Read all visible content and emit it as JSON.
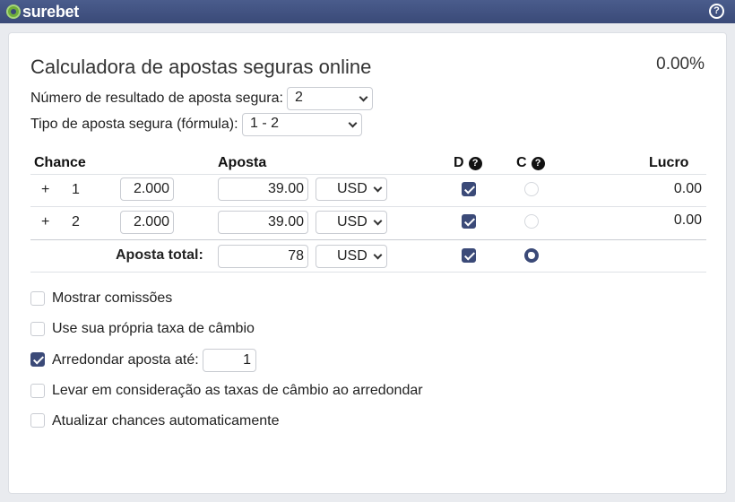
{
  "header": {
    "brand": "surebet",
    "help_glyph": "?"
  },
  "colors": {
    "header_bg": "#3a4a78",
    "accent": "#3b4a78",
    "logo_green": "#6fae3a"
  },
  "calculator": {
    "title": "Calculadora de apostas seguras online",
    "percent": "0.00%",
    "outcomes_label": "Número de resultado de aposta segura:",
    "outcomes_value": "2",
    "formula_label": "Tipo de aposta segura (fórmula):",
    "formula_value": "1 - 2",
    "columns": {
      "chance": "Chance",
      "aposta": "Aposta",
      "d": "D",
      "c": "C",
      "lucro": "Lucro",
      "q": "?"
    },
    "rows": [
      {
        "plus": "+",
        "num": "1",
        "odds": "2.000",
        "stake": "39.00",
        "currency": "USD",
        "d_checked": true,
        "c_checked": false,
        "profit": "0.00"
      },
      {
        "plus": "+",
        "num": "2",
        "odds": "2.000",
        "stake": "39.00",
        "currency": "USD",
        "d_checked": true,
        "c_checked": false,
        "profit": "0.00"
      }
    ],
    "total": {
      "label": "Aposta total:",
      "stake": "78",
      "currency": "USD",
      "d_checked": true,
      "c_checked": true
    }
  },
  "options": {
    "show_commissions": {
      "label": "Mostrar comissões",
      "checked": false
    },
    "own_rate": {
      "label": "Use sua própria taxa de câmbio",
      "checked": false
    },
    "round_bet": {
      "label": "Arredondar aposta até:",
      "checked": true,
      "value": "1"
    },
    "consider_rates": {
      "label": "Levar em consideração as taxas de câmbio ao arredondar",
      "checked": false
    },
    "auto_update": {
      "label": "Atualizar chances automaticamente",
      "checked": false
    }
  }
}
